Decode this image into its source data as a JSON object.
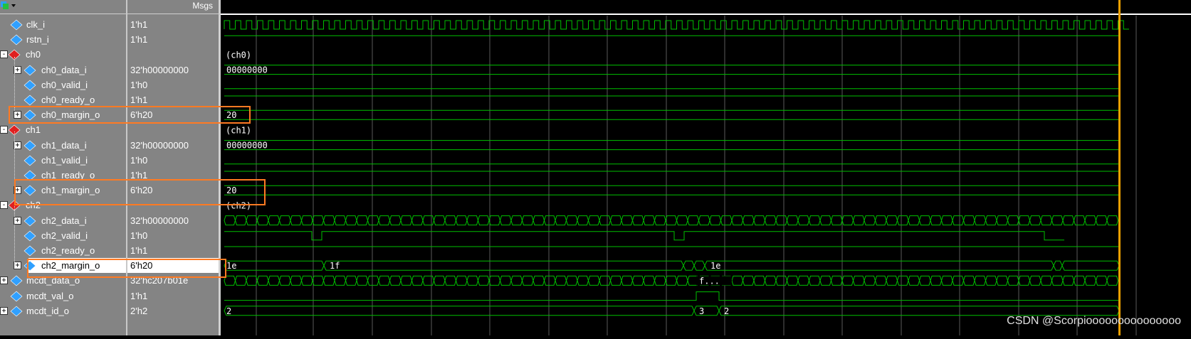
{
  "header": {
    "msgs_label": "Msgs"
  },
  "signals": [
    {
      "name": "clk_i",
      "value": "1'h1",
      "kind": "leaf",
      "indent": 1,
      "expander": ""
    },
    {
      "name": "rstn_i",
      "value": "1'h1",
      "kind": "leaf",
      "indent": 1,
      "expander": ""
    },
    {
      "name": "ch0",
      "value": "",
      "kind": "group",
      "indent": 0,
      "expander": "-"
    },
    {
      "name": "ch0_data_i",
      "value": "32'h00000000",
      "kind": "bus",
      "indent": 2,
      "expander": "+"
    },
    {
      "name": "ch0_valid_i",
      "value": "1'h0",
      "kind": "leaf",
      "indent": 2,
      "expander": ""
    },
    {
      "name": "ch0_ready_o",
      "value": "1'h1",
      "kind": "leaf",
      "indent": 2,
      "expander": ""
    },
    {
      "name": "ch0_margin_o",
      "value": "6'h20",
      "kind": "bus",
      "indent": 2,
      "expander": "+"
    },
    {
      "name": "ch1",
      "value": "",
      "kind": "group",
      "indent": 0,
      "expander": "-"
    },
    {
      "name": "ch1_data_i",
      "value": "32'h00000000",
      "kind": "bus",
      "indent": 2,
      "expander": "+"
    },
    {
      "name": "ch1_valid_i",
      "value": "1'h0",
      "kind": "leaf",
      "indent": 2,
      "expander": ""
    },
    {
      "name": "ch1_ready_o",
      "value": "1'h1",
      "kind": "leaf",
      "indent": 2,
      "expander": ""
    },
    {
      "name": "ch1_margin_o",
      "value": "6'h20",
      "kind": "bus",
      "indent": 2,
      "expander": "+"
    },
    {
      "name": "ch2",
      "value": "",
      "kind": "group",
      "indent": 0,
      "expander": "-"
    },
    {
      "name": "ch2_data_i",
      "value": "32'h00000000",
      "kind": "bus",
      "indent": 2,
      "expander": "+"
    },
    {
      "name": "ch2_valid_i",
      "value": "1'h0",
      "kind": "leaf",
      "indent": 2,
      "expander": ""
    },
    {
      "name": "ch2_ready_o",
      "value": "1'h1",
      "kind": "leaf",
      "indent": 2,
      "expander": ""
    },
    {
      "name": "ch2_margin_o",
      "value": "6'h20",
      "kind": "bus",
      "indent": 2,
      "expander": "+",
      "selected": true
    },
    {
      "name": "mcdt_data_o",
      "value": "32'hc207b01e",
      "kind": "bus",
      "indent": 1,
      "expander": "+"
    },
    {
      "name": "mcdt_val_o",
      "value": "1'h1",
      "kind": "leaf",
      "indent": 1,
      "expander": ""
    },
    {
      "name": "mcdt_id_o",
      "value": "2'h2",
      "kind": "bus",
      "indent": 1,
      "expander": "+"
    }
  ],
  "wave_labels": {
    "ch0_group": "(ch0)",
    "ch0_data": "00000000",
    "ch0_margin": "20",
    "ch1_group": "(ch1)",
    "ch1_data": "00000000",
    "ch1_margin": "20",
    "ch2_group": "(ch2)",
    "ch2_margin_a": "1e",
    "ch2_margin_b": "1f",
    "ch2_margin_c": "1e",
    "mcdt_data": "f...",
    "mcdt_id_a": "2",
    "mcdt_id_b": "3",
    "mcdt_id_c": "2"
  },
  "watermark": "CSDN @Scorpiooooooooooooooo",
  "colors": {
    "wave": "#00c000",
    "grid": "#5a5a5a",
    "cursor": "#f0a000",
    "highlight": "#ff7a22",
    "panel": "#848484"
  }
}
